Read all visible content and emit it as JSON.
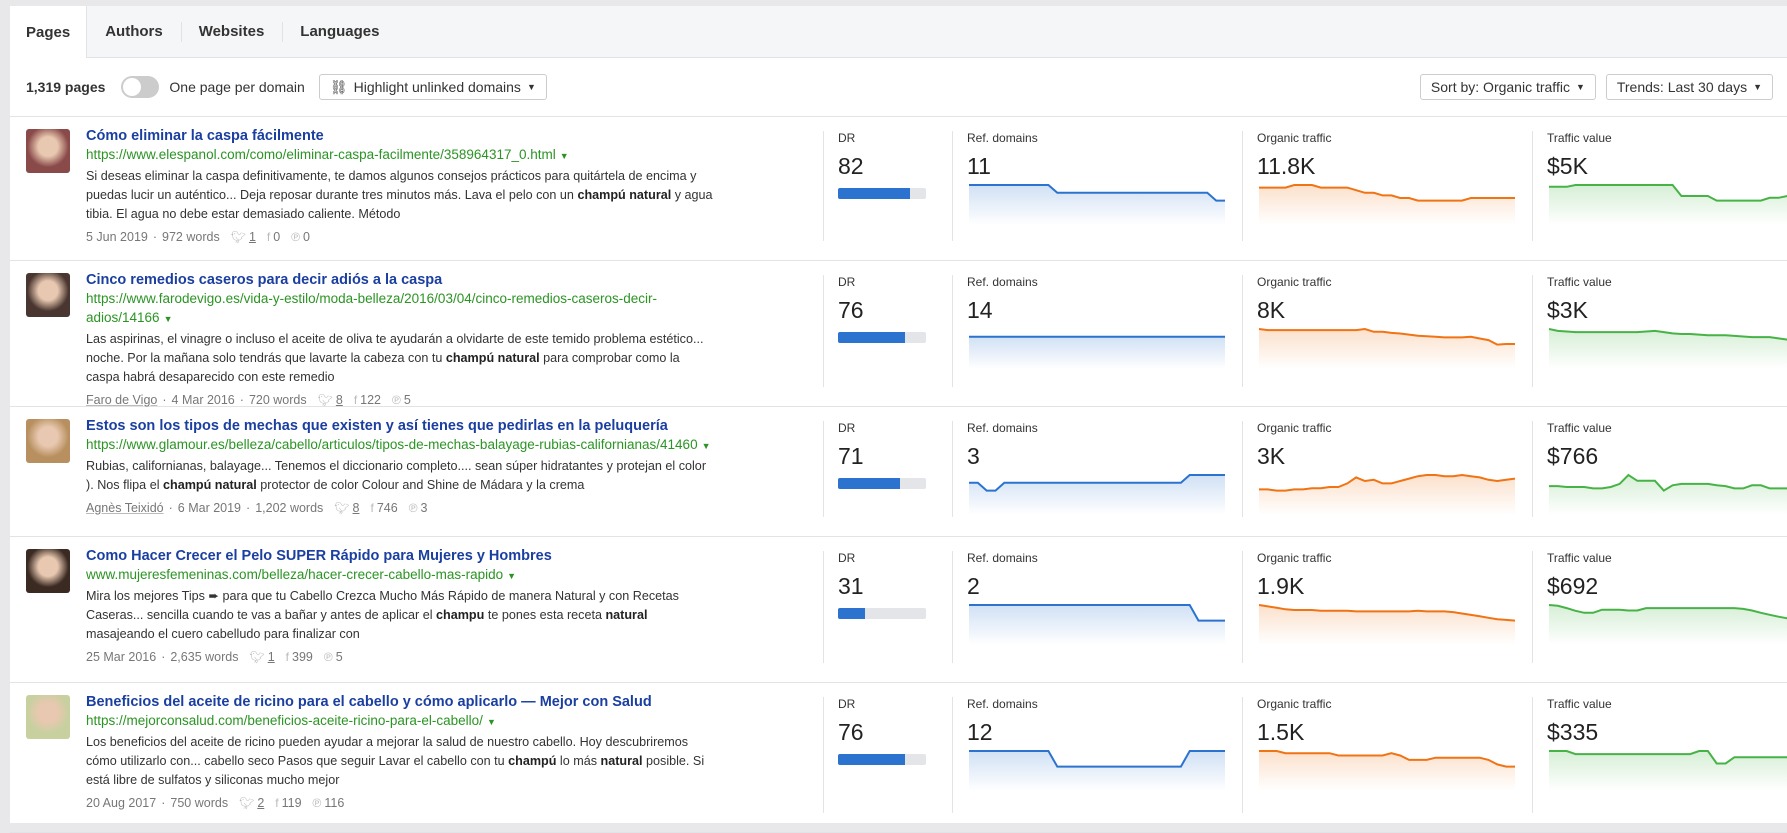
{
  "tabs": [
    "Pages",
    "Authors",
    "Websites",
    "Languages"
  ],
  "toolbar": {
    "count": "1,319 pages",
    "toggle_label": "One page per domain",
    "toggle_on": false,
    "highlight": "Highlight unlinked domains",
    "sort": "Sort by: Organic traffic",
    "trends": "Trends: Last 30 days"
  },
  "labels": {
    "dr": "DR",
    "ref": "Ref. domains",
    "org": "Organic traffic",
    "tv": "Traffic value"
  },
  "colors": {
    "ref": "#2b73cf",
    "org": "#f07314",
    "tv": "#47b347",
    "title": "#1b3fa0",
    "url": "#2b9424"
  },
  "rows": [
    {
      "title": "Cómo eliminar la caspa fácilmente",
      "url": "https://www.elespanol.com/como/eliminar-caspa-facilmente/358964317_0.html",
      "snippet": [
        {
          "t": "Si deseas eliminar la caspa definitivamente, te damos algunos consejos prácticos para quitártela de encima y puedas lucir un auténtico... Deja reposar durante tres minutos más. Lava el pelo con un "
        },
        {
          "t": "champú natural",
          "b": true
        },
        {
          "t": " y agua tibia. El agua no debe estar demasiado caliente. Método"
        }
      ],
      "author": "",
      "date": "5 Jun 2019",
      "words": "972 words",
      "twitter": "1",
      "facebook": "0",
      "pinterest": "0",
      "dr": "82",
      "dr_pct": 82,
      "ref": "11",
      "org": "11.8K",
      "tv": "$5K",
      "thumb": "#8a4a4a",
      "ref_trend": [
        11,
        11,
        11,
        11,
        11,
        11,
        11,
        11,
        11,
        11,
        10.7,
        10.7,
        10.7,
        10.7,
        10.7,
        10.7,
        10.7,
        10.7,
        10.7,
        10.7,
        10.7,
        10.7,
        10.7,
        10.7,
        10.7,
        10.7,
        10.7,
        10.7,
        10.4,
        10.4
      ],
      "org_trend": [
        12.0,
        12.0,
        12.0,
        12.0,
        12.05,
        12.05,
        12.05,
        12.0,
        12.0,
        12.0,
        12.0,
        11.95,
        11.9,
        11.9,
        11.85,
        11.85,
        11.8,
        11.8,
        11.75,
        11.75,
        11.75,
        11.75,
        11.75,
        11.75,
        11.8,
        11.8,
        11.8,
        11.8,
        11.8,
        11.8
      ],
      "tv_trend": [
        5.1,
        5.1,
        5.1,
        5.12,
        5.12,
        5.12,
        5.12,
        5.12,
        5.12,
        5.12,
        5.12,
        5.12,
        5.12,
        5.12,
        5.12,
        5.0,
        5.0,
        5.0,
        5.0,
        4.95,
        4.95,
        4.95,
        4.95,
        4.95,
        4.95,
        4.98,
        4.98,
        5.0,
        5.0,
        5.0
      ]
    },
    {
      "title": "Cinco remedios caseros para decir adiós a la caspa",
      "url": "https://www.farodevigo.es/vida-y-estilo/moda-belleza/2016/03/04/cinco-remedios-caseros-decir-adios/14166",
      "snippet": [
        {
          "t": "Las aspirinas, el vinagre o incluso el aceite de oliva te ayudarán a olvidarte de este temido problema estético... noche. Por la mañana solo tendrás que lavarte la cabeza con tu "
        },
        {
          "t": "champú natural",
          "b": true
        },
        {
          "t": " para comprobar como la caspa habrá desaparecido con este remedio"
        }
      ],
      "author": "Faro de Vigo",
      "date": "4 Mar 2016",
      "words": "720 words",
      "twitter": "8",
      "facebook": "122",
      "pinterest": "5",
      "dr": "76",
      "dr_pct": 76,
      "ref": "14",
      "org": "8K",
      "tv": "$3K",
      "thumb": "#4a3630",
      "ref_trend": [
        14,
        14,
        14,
        14,
        14,
        14,
        14,
        14,
        14,
        14,
        14,
        14,
        14,
        14,
        14,
        14,
        14,
        14,
        14,
        14,
        14,
        14,
        14,
        14,
        14,
        14,
        14,
        14,
        14,
        14
      ],
      "org_trend": [
        8.2,
        8.18,
        8.18,
        8.18,
        8.18,
        8.18,
        8.18,
        8.18,
        8.18,
        8.18,
        8.18,
        8.18,
        8.2,
        8.15,
        8.15,
        8.13,
        8.12,
        8.1,
        8.08,
        8.07,
        8.06,
        8.05,
        8.05,
        8.05,
        8.06,
        8.03,
        8.0,
        7.92,
        7.93,
        7.93
      ],
      "tv_trend": [
        3.15,
        3.12,
        3.11,
        3.1,
        3.1,
        3.1,
        3.1,
        3.1,
        3.1,
        3.1,
        3.1,
        3.11,
        3.12,
        3.1,
        3.08,
        3.07,
        3.07,
        3.06,
        3.05,
        3.05,
        3.05,
        3.04,
        3.03,
        3.02,
        3.02,
        3.02,
        3.0,
        2.98,
        2.92,
        2.9
      ]
    },
    {
      "title": "Estos son los tipos de mechas que existen y así tienes que pedirlas en la peluquería",
      "url": "https://www.glamour.es/belleza/cabello/articulos/tipos-de-mechas-balayage-rubias-californianas/41460",
      "snippet": [
        {
          "t": "Rubias, californianas, balayage... Tenemos el diccionario completo.... sean súper hidratantes y protejan el color ). Nos flipa el "
        },
        {
          "t": "champú natural",
          "b": true
        },
        {
          "t": " protector de color Colour and Shine de Mádara y la crema"
        }
      ],
      "author": "Agnès Teixidó",
      "date": "6 Mar 2019",
      "words": "1,202 words",
      "twitter": "8",
      "facebook": "746",
      "pinterest": "3",
      "dr": "71",
      "dr_pct": 71,
      "ref": "3",
      "org": "3K",
      "tv": "$766",
      "thumb": "#b89060",
      "ref_trend": [
        3,
        3,
        2.4,
        2.4,
        3,
        3,
        3,
        3,
        3,
        3,
        3,
        3,
        3,
        3,
        3,
        3,
        3,
        3,
        3,
        3,
        3,
        3,
        3,
        3,
        3,
        3.6,
        3.6,
        3.6,
        3.6,
        3.6
      ],
      "org_trend": [
        2.95,
        2.95,
        2.94,
        2.94,
        2.95,
        2.95,
        2.96,
        2.96,
        2.97,
        2.97,
        3.0,
        3.05,
        3.02,
        3.03,
        3.0,
        3.0,
        3.02,
        3.04,
        3.06,
        3.07,
        3.07,
        3.06,
        3.06,
        3.07,
        3.06,
        3.05,
        3.03,
        3.02,
        3.03,
        3.04
      ],
      "tv_trend": [
        740,
        740,
        738,
        738,
        738,
        735,
        735,
        738,
        745,
        765,
        752,
        752,
        752,
        730,
        742,
        745,
        745,
        745,
        745,
        742,
        740,
        735,
        735,
        742,
        742,
        735,
        735,
        735,
        735,
        735
      ]
    },
    {
      "title": "Como Hacer Crecer el Pelo SUPER Rápido para Mujeres y Hombres",
      "url": "www.mujeresfemeninas.com/belleza/hacer-crecer-cabello-mas-rapido",
      "snippet": [
        {
          "t": "Mira los mejores Tips ➨ para que tu Cabello Crezca Mucho Más Rápido de manera Natural y con Recetas Caseras... sencilla cuando te vas a bañar y antes de aplicar el "
        },
        {
          "t": "champu",
          "b": true
        },
        {
          "t": " te pones esta receta "
        },
        {
          "t": "natural",
          "b": true
        },
        {
          "t": " masajeando el cuero cabelludo para finalizar con"
        }
      ],
      "author": "",
      "date": "25 Mar 2016",
      "words": "2,635 words",
      "twitter": "1",
      "facebook": "399",
      "pinterest": "5",
      "dr": "31",
      "dr_pct": 31,
      "ref": "2",
      "org": "1.9K",
      "tv": "$692",
      "thumb": "#3a2a22",
      "ref_trend": [
        2.5,
        2.5,
        2.5,
        2.5,
        2.5,
        2.5,
        2.5,
        2.5,
        2.5,
        2.5,
        2.5,
        2.5,
        2.5,
        2.5,
        2.5,
        2.5,
        2.5,
        2.5,
        2.5,
        2.5,
        2.5,
        2.5,
        2.5,
        2.5,
        2.5,
        2.5,
        2,
        2,
        2,
        2
      ],
      "org_trend": [
        2.0,
        1.98,
        1.96,
        1.94,
        1.93,
        1.93,
        1.93,
        1.92,
        1.92,
        1.92,
        1.92,
        1.91,
        1.91,
        1.91,
        1.91,
        1.91,
        1.91,
        1.91,
        1.92,
        1.91,
        1.91,
        1.91,
        1.9,
        1.88,
        1.86,
        1.84,
        1.82,
        1.8,
        1.79,
        1.78
      ],
      "tv_trend": [
        720,
        718,
        712,
        705,
        700,
        700,
        708,
        708,
        708,
        706,
        706,
        712,
        712,
        712,
        712,
        712,
        712,
        712,
        712,
        712,
        712,
        712,
        710,
        706,
        700,
        695,
        690,
        686,
        683,
        680
      ]
    },
    {
      "title": "Beneficios del aceite de ricino para el cabello y cómo aplicarlo — Mejor con Salud",
      "url": "https://mejorconsalud.com/beneficios-aceite-ricino-para-el-cabello/",
      "snippet": [
        {
          "t": "Los beneficios del aceite de ricino pueden ayudar a mejorar la salud de nuestro cabello. Hoy descubriremos cómo utilizarlo con... cabello seco Pasos que seguir Lavar el cabello con tu "
        },
        {
          "t": "champú",
          "b": true
        },
        {
          "t": "  lo más "
        },
        {
          "t": "natural",
          "b": true
        },
        {
          "t": " posible. Si está libre de sulfatos y siliconas mucho mejor"
        }
      ],
      "author": "",
      "date": "20 Aug 2017",
      "words": "750 words",
      "twitter": "2",
      "facebook": "119",
      "pinterest": "116",
      "dr": "76",
      "dr_pct": 76,
      "ref": "12",
      "org": "1.5K",
      "tv": "$335",
      "thumb": "#c8d0a0",
      "ref_trend": [
        12,
        12,
        12,
        12,
        12,
        12,
        12,
        12,
        12,
        12,
        11.8,
        11.8,
        11.8,
        11.8,
        11.8,
        11.8,
        11.8,
        11.8,
        11.8,
        11.8,
        11.8,
        11.8,
        11.8,
        11.8,
        11.8,
        12,
        12,
        12,
        12,
        12
      ],
      "org_trend": [
        1.56,
        1.56,
        1.56,
        1.55,
        1.55,
        1.55,
        1.55,
        1.55,
        1.55,
        1.54,
        1.54,
        1.54,
        1.54,
        1.54,
        1.54,
        1.55,
        1.54,
        1.52,
        1.52,
        1.52,
        1.53,
        1.53,
        1.53,
        1.53,
        1.53,
        1.53,
        1.52,
        1.5,
        1.49,
        1.49
      ],
      "tv_trend": [
        340,
        340,
        340,
        339,
        339,
        339,
        339,
        339,
        339,
        339,
        339,
        339,
        339,
        339,
        339,
        339,
        339,
        340,
        340,
        336,
        336,
        338,
        338,
        338,
        338,
        338,
        338,
        338,
        338,
        335
      ]
    }
  ]
}
